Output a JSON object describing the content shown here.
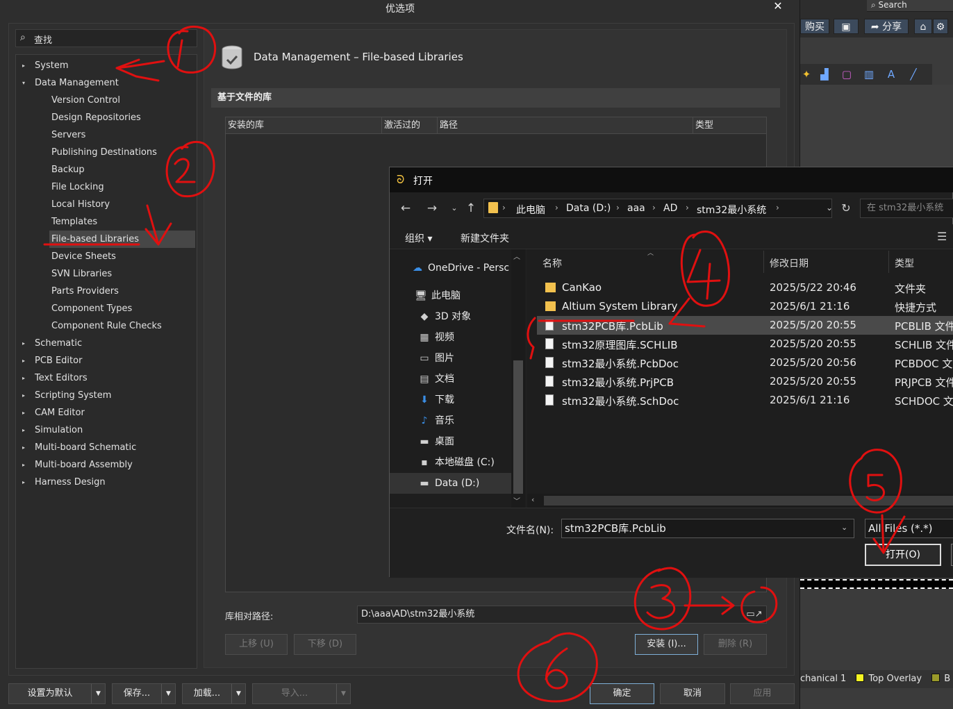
{
  "background_app": {
    "search_label": "Search",
    "buy_label": "购买",
    "share_label": "分享",
    "layers": [
      {
        "label": "chanical 1",
        "color": ""
      },
      {
        "label": "Top Overlay",
        "color": "#f5f522"
      },
      {
        "label": "B",
        "color": "#9a9a2a"
      }
    ]
  },
  "preferences": {
    "title": "优选项",
    "search_placeholder": "查找",
    "tree": [
      {
        "label": "System",
        "level": 0,
        "arrow": "▸"
      },
      {
        "label": "Data Management",
        "level": 0,
        "arrow": "▾"
      },
      {
        "label": "Version Control",
        "level": 1
      },
      {
        "label": "Design Repositories",
        "level": 1
      },
      {
        "label": "Servers",
        "level": 1
      },
      {
        "label": "Publishing Destinations",
        "level": 1
      },
      {
        "label": "Backup",
        "level": 1
      },
      {
        "label": "File Locking",
        "level": 1
      },
      {
        "label": "Local History",
        "level": 1
      },
      {
        "label": "Templates",
        "level": 1
      },
      {
        "label": "File-based Libraries",
        "level": 1,
        "selected": true
      },
      {
        "label": "Device Sheets",
        "level": 1
      },
      {
        "label": "SVN Libraries",
        "level": 1
      },
      {
        "label": "Parts Providers",
        "level": 1
      },
      {
        "label": "Component Types",
        "level": 1
      },
      {
        "label": "Component Rule Checks",
        "level": 1
      },
      {
        "label": "Schematic",
        "level": 0,
        "arrow": "▸"
      },
      {
        "label": "PCB Editor",
        "level": 0,
        "arrow": "▸"
      },
      {
        "label": "Text Editors",
        "level": 0,
        "arrow": "▸"
      },
      {
        "label": "Scripting System",
        "level": 0,
        "arrow": "▸"
      },
      {
        "label": "CAM Editor",
        "level": 0,
        "arrow": "▸"
      },
      {
        "label": "Simulation",
        "level": 0,
        "arrow": "▸"
      },
      {
        "label": "Multi-board Schematic",
        "level": 0,
        "arrow": "▸"
      },
      {
        "label": "Multi-board Assembly",
        "level": 0,
        "arrow": "▸"
      },
      {
        "label": "Harness Design",
        "level": 0,
        "arrow": "▸"
      }
    ],
    "page_title": "Data Management – File-based Libraries",
    "section_title": "基于文件的库",
    "table_columns": [
      "安装的库",
      "激活过的",
      "路径",
      "类型"
    ],
    "relative_path_label": "库相对路径:",
    "relative_path_value": "D:\\aaa\\AD\\stm32最小系统",
    "buttons": {
      "move_up": "上移 (U)",
      "move_down": "下移 (D)",
      "install": "安装 (I)...",
      "remove": "删除 (R)"
    },
    "footer": {
      "set_default": "设置为默认",
      "save": "保存...",
      "load": "加载...",
      "import": "导入...",
      "ok": "确定",
      "cancel": "取消",
      "apply": "应用"
    }
  },
  "open_dialog": {
    "title": "打开",
    "breadcrumbs": [
      "此电脑",
      "Data (D:)",
      "aaa",
      "AD",
      "stm32最小系统"
    ],
    "search_placeholder": "在 stm32最小系统",
    "commands": {
      "organize": "组织 ▾",
      "new_folder": "新建文件夹"
    },
    "nav_items": [
      {
        "label": "OneDrive - Persc",
        "icon": "☁",
        "indent": 0
      },
      {
        "label": "此电脑",
        "icon": "🖥",
        "indent": 1
      },
      {
        "label": "3D 对象",
        "icon": "◆",
        "indent": 2
      },
      {
        "label": "视频",
        "icon": "▦",
        "indent": 2
      },
      {
        "label": "图片",
        "icon": "▭",
        "indent": 2
      },
      {
        "label": "文档",
        "icon": "▤",
        "indent": 2
      },
      {
        "label": "下载",
        "icon": "⬇",
        "indent": 2
      },
      {
        "label": "音乐",
        "icon": "♪",
        "indent": 2
      },
      {
        "label": "桌面",
        "icon": "▬",
        "indent": 2
      },
      {
        "label": "本地磁盘 (C:)",
        "icon": "▪",
        "indent": 2
      },
      {
        "label": "Data (D:)",
        "icon": "▬",
        "indent": 2,
        "selected": true
      }
    ],
    "columns": {
      "name": "名称",
      "modified": "修改日期",
      "type": "类型"
    },
    "files": [
      {
        "name": "CanKao",
        "date": "2025/5/22 20:46",
        "type": "文件夹",
        "kind": "folder"
      },
      {
        "name": "Altium System Library",
        "date": "2025/6/1 21:16",
        "type": "快捷方式",
        "kind": "shortcut"
      },
      {
        "name": "stm32PCB库.PcbLib",
        "date": "2025/5/20 20:55",
        "type": "PCBLIB 文件",
        "kind": "doc",
        "selected": true
      },
      {
        "name": "stm32原理图库.SCHLIB",
        "date": "2025/5/20 20:55",
        "type": "SCHLIB 文件",
        "kind": "doc"
      },
      {
        "name": "stm32最小系统.PcbDoc",
        "date": "2025/5/20 20:56",
        "type": "PCBDOC 文件",
        "kind": "doc"
      },
      {
        "name": "stm32最小系统.PrjPCB",
        "date": "2025/5/20 20:55",
        "type": "PRJPCB 文件",
        "kind": "doc"
      },
      {
        "name": "stm32最小系统.SchDoc",
        "date": "2025/6/1 21:16",
        "type": "SCHDOC 文件",
        "kind": "doc"
      }
    ],
    "filename_label": "文件名(N):",
    "filename_value": "stm32PCB库.PcbLib",
    "filetype_value": "All Files (*.*)",
    "open_button": "打开(O)"
  },
  "annotations": {
    "color": "#e01010",
    "marks": [
      "1",
      "2",
      "3",
      "4",
      "5",
      "6"
    ]
  }
}
